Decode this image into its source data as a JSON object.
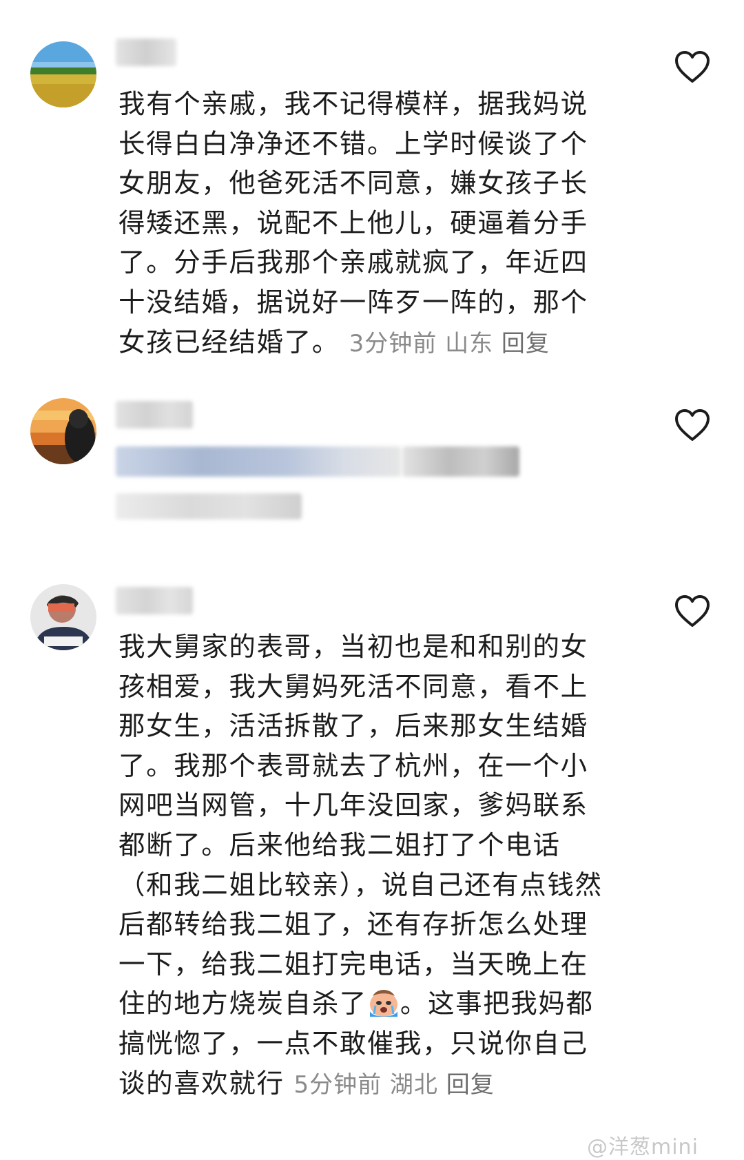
{
  "comments": [
    {
      "text": "我有个亲戚，我不记得模样，据我妈说长得白白净净还不错。上学时候谈了个女朋友，他爸死活不同意，嫌女孩子长得矮还黑，说配不上他儿，硬逼着分手了。分手后我那个亲戚就疯了，年近四十没结婚，据说好一阵歹一阵的，那个女孩已经结婚了。",
      "time": "3分钟前",
      "location": "山东",
      "reply_label": "回复",
      "avatar_icon": "landscape-field-avatar-icon",
      "like_icon": "heart-outline-icon"
    },
    {
      "avatar_icon": "sunset-person-avatar-icon",
      "like_icon": "heart-outline-icon"
    },
    {
      "text_before_emoji": "我大舅家的表哥，当初也是和和别的女孩相爱，我大舅妈死活不同意，看不上那女生，活活拆散了，后来那女生结婚了。我那个表哥就去了杭州，在一个小网吧当网管，十几年没回家，爹妈联系都断了。后来他给我二姐打了个电话（和我二姐比较亲），说自己还有点钱然后都转给我二姐了，还有存折怎么处理一下，给我二姐打完电话，当天晚上在住的地方烧炭自杀了",
      "emoji_icon": "crying-emoji-icon",
      "text_after_emoji": "。这事把我妈都搞恍惚了，一点不敢催我，只说你自己谈的喜欢就行",
      "time": "5分钟前",
      "location": "湖北",
      "reply_label": "回复",
      "avatar_icon": "person-drawing-avatar-icon",
      "like_icon": "heart-outline-icon"
    }
  ],
  "watermark": "@洋葱mini",
  "colors": {
    "text": "#1c1c1c",
    "meta": "#8a8a8a",
    "blur_gray": "#d6d6d6",
    "blur_blue": "#b9c6dd"
  }
}
